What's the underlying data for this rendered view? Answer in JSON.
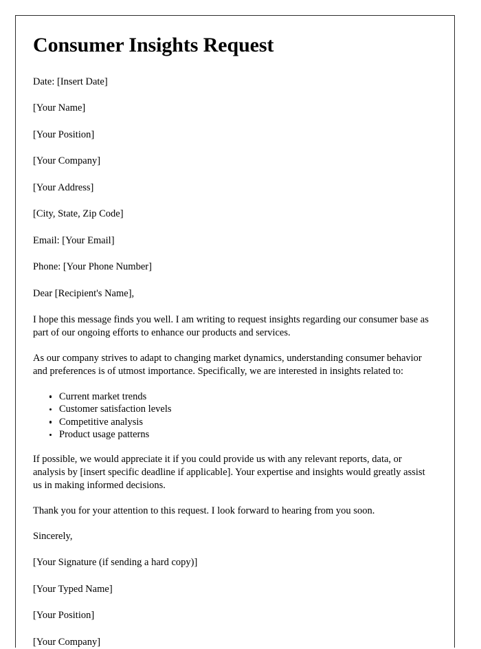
{
  "document": {
    "title": "Consumer Insights Request",
    "date_line": "Date: [Insert Date]",
    "sender_block": [
      "[Your Name]",
      "[Your Position]",
      "[Your Company]",
      "[Your Address]",
      "[City, State, Zip Code]",
      "Email: [Your Email]",
      "Phone: [Your Phone Number]"
    ],
    "salutation": "Dear [Recipient's Name],",
    "paragraphs": [
      "I hope this message finds you well. I am writing to request insights regarding our consumer base as part of our ongoing efforts to enhance our products and services.",
      "As our company strives to adapt to changing market dynamics, understanding consumer behavior and preferences is of utmost importance. Specifically, we are interested in insights related to:"
    ],
    "bullets": [
      "Current market trends",
      "Customer satisfaction levels",
      "Competitive analysis",
      "Product usage patterns"
    ],
    "paragraphs_after_list": [
      "If possible, we would appreciate it if you could provide us with any relevant reports, data, or analysis by [insert specific deadline if applicable]. Your expertise and insights would greatly assist us in making informed decisions.",
      "Thank you for your attention to this request. I look forward to hearing from you soon."
    ],
    "closing": "Sincerely,",
    "signature_block": [
      "[Your Signature (if sending a hard copy)]",
      "[Your Typed Name]",
      "[Your Position]",
      "[Your Company]"
    ]
  },
  "colors": {
    "text": "#000000",
    "page_border": "#2b2b2b",
    "background": "#ffffff"
  }
}
